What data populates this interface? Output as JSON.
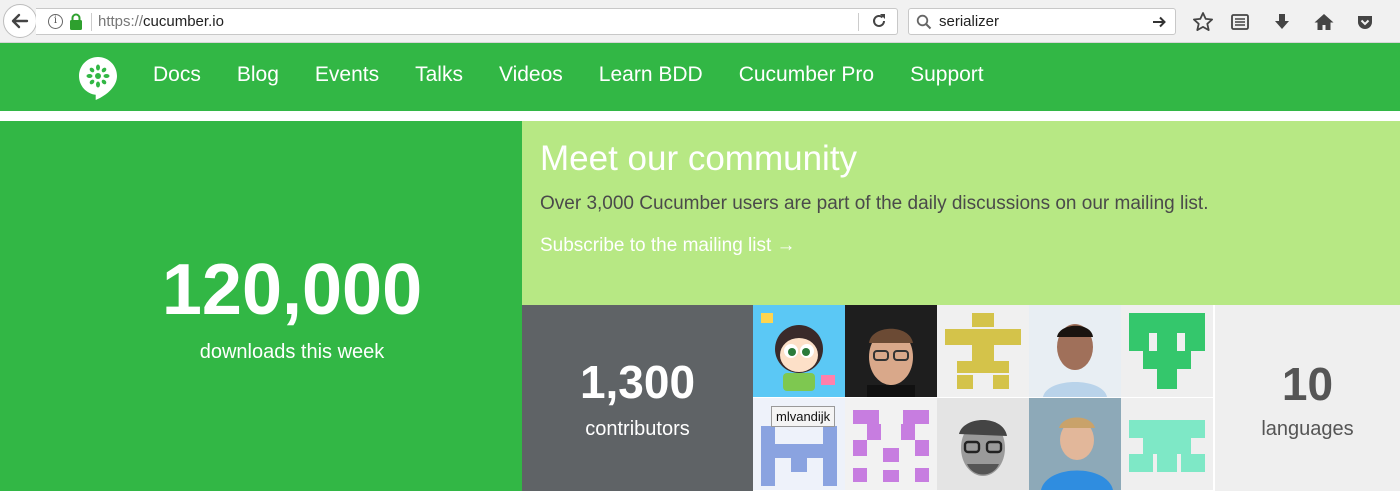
{
  "browser": {
    "url_protocol": "https://",
    "url_host": "cucumber.io",
    "search_query": "serializer"
  },
  "nav": {
    "links": [
      "Docs",
      "Blog",
      "Events",
      "Talks",
      "Videos",
      "Learn BDD",
      "Cucumber Pro",
      "Support"
    ]
  },
  "downloads": {
    "number": "120,000",
    "label": "downloads this week"
  },
  "community": {
    "title": "Meet our community",
    "description": "Over 3,000 Cucumber users are part of the daily discussions on our mailing list.",
    "link": "Subscribe to the mailing list →"
  },
  "contributors": {
    "number": "1,300",
    "label": "contributors",
    "tooltip": "mlvandijk"
  },
  "languages": {
    "number": "10",
    "label": "languages"
  },
  "colors": {
    "brand_green": "#32b745",
    "light_green": "#b7e884",
    "dark_gray": "#5f6366"
  }
}
